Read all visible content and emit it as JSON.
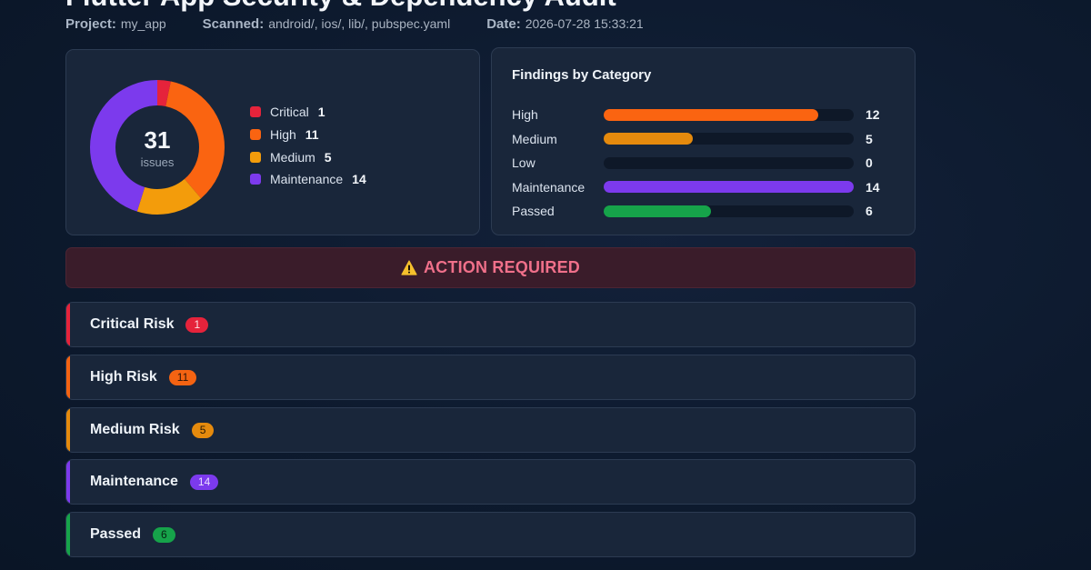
{
  "header": {
    "title": "Flutter App Security & Dependency Audit",
    "project_label": "Project:",
    "project": "my_app",
    "scanned_label": "Scanned:",
    "scanned": "android/, ios/, lib/, pubspec.yaml",
    "date_label": "Date:",
    "date": "2026-07-28 15:33:21"
  },
  "summary": {
    "total": "31",
    "total_label": "issues",
    "legend": [
      {
        "label": "Critical",
        "value": "1",
        "color": "#e5233b"
      },
      {
        "label": "High",
        "value": "11",
        "color": "#fa6411"
      },
      {
        "label": "Medium",
        "value": "5",
        "color": "#f39c0b"
      },
      {
        "label": "Maintenance",
        "value": "14",
        "color": "#7c3aed"
      }
    ]
  },
  "category": {
    "title": "Findings by Category"
  },
  "chart_data": [
    {
      "type": "pie",
      "categories": [
        "Critical",
        "High",
        "Medium",
        "Maintenance"
      ],
      "values": [
        1,
        11,
        5,
        14
      ],
      "colors": [
        "#e5233b",
        "#fa6411",
        "#f39c0b",
        "#7c3aed"
      ]
    },
    {
      "type": "bar",
      "title": "Findings by Category",
      "categories": [
        "High",
        "Medium",
        "Low",
        "Maintenance",
        "Passed"
      ],
      "values": [
        12,
        5,
        0,
        14,
        6
      ],
      "colors": [
        "#fa6411",
        "#e58a0d",
        "#3b4a60",
        "#7c3aed",
        "#16a34a"
      ],
      "xlim": [
        0,
        14
      ]
    }
  ],
  "alert": {
    "text": "ACTION REQUIRED"
  },
  "risk_sections": [
    {
      "label": "Critical Risk",
      "count": "1",
      "color": "#e5233b",
      "badge_text": "#fde2e6"
    },
    {
      "label": "High Risk",
      "count": "11",
      "color": "#f46312",
      "badge_text": "#2a1406"
    },
    {
      "label": "Medium Risk",
      "count": "5",
      "color": "#e58a0d",
      "badge_text": "#2a1a04"
    },
    {
      "label": "Maintenance",
      "count": "14",
      "color": "#7c3aed",
      "badge_text": "#e9ddff"
    },
    {
      "label": "Passed",
      "count": "6",
      "color": "#16a34a",
      "badge_text": "#072312"
    }
  ]
}
